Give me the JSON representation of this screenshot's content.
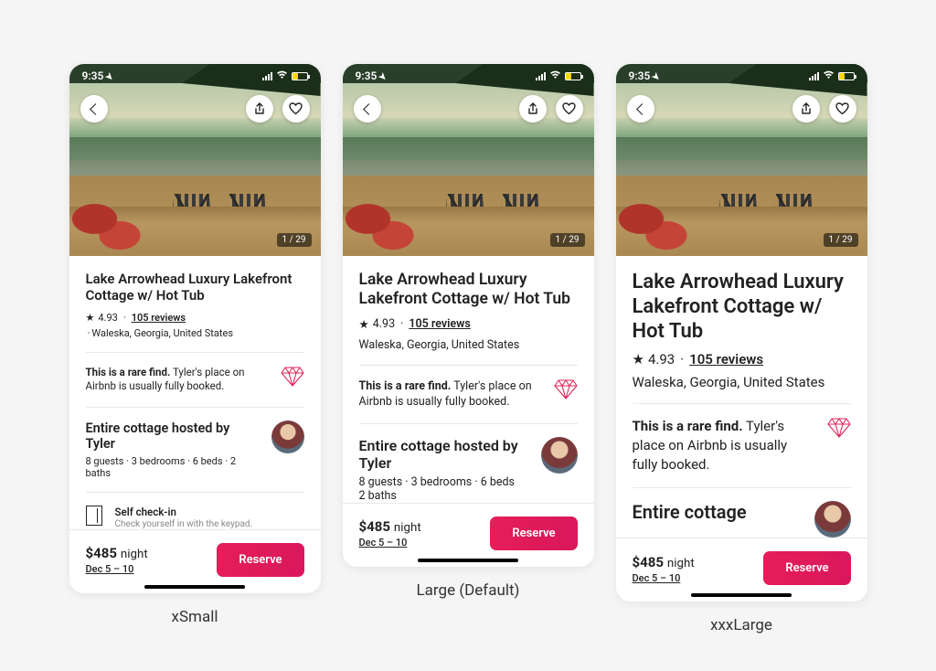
{
  "status": {
    "time": "9:35"
  },
  "pager": "1 / 29",
  "listing": {
    "title": "Lake Arrowhead Luxury Lakefront Cottage w/ Hot Tub",
    "rating": "4.93",
    "reviews": "105 reviews",
    "location": "Waleska, Georgia, United States"
  },
  "rare": {
    "bold": "This is a rare find.",
    "rest": "Tyler's place on Airbnb is usually fully booked."
  },
  "host": {
    "title_xs_lg": "Entire cottage hosted by Tyler",
    "title_xxxl": "Entire cottage",
    "stats_xs": "8 guests · 3 bedrooms · 6 beds · 2 baths",
    "stats_lg_l1": "8 guests · 3 bedrooms · 6 beds",
    "stats_lg_l2": "2 baths"
  },
  "selfcheck": {
    "title": "Self check-in",
    "sub": "Check yourself in with the keypad."
  },
  "footer": {
    "price": "$485",
    "unit": "night",
    "dates": "Dec 5 – 10",
    "reserve": "Reserve"
  },
  "captions": {
    "xs": "xSmall",
    "lg": "Large (Default)",
    "xxxl": "xxxLarge"
  }
}
